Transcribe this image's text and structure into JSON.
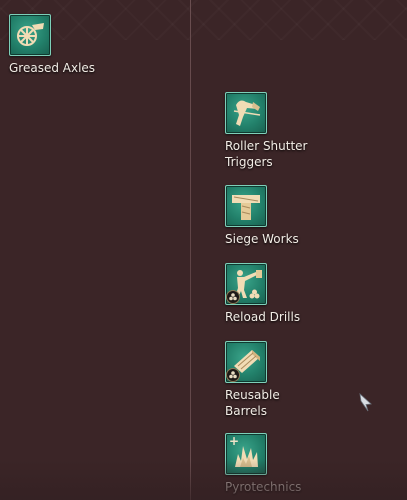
{
  "techs": [
    {
      "id": "greased-axles",
      "label": "Greased Axles",
      "icon": "wheel-icon",
      "badge": null
    },
    {
      "id": "roller-shutter-triggers",
      "label": "Roller Shutter\nTriggers",
      "icon": "archer-icon",
      "badge": null
    },
    {
      "id": "siege-works",
      "label": "Siege Works",
      "icon": "wooden-beam-icon",
      "badge": null
    },
    {
      "id": "reload-drills",
      "label": "Reload Drills",
      "icon": "soldier-loading-icon",
      "badge": "cannonball-badge-icon"
    },
    {
      "id": "reusable-barrels",
      "label": "Reusable\nBarrels",
      "icon": "barrel-plank-icon",
      "badge": "cannonball-badge-icon"
    },
    {
      "id": "pyrotechnics",
      "label": "Pyrotechnics",
      "icon": "fire-burst-icon",
      "badge": "plus-icon"
    }
  ],
  "colors": {
    "background": "#3b2527",
    "tile": "#22806a",
    "tile_border": "#7dd0b9",
    "icon": "#f1dcb5",
    "text": "#f3ede6"
  }
}
